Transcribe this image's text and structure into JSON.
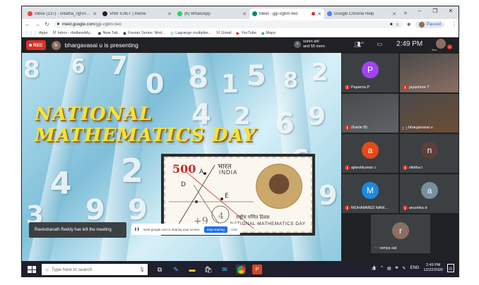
{
  "browser": {
    "tabs": [
      {
        "label": "Inbox (137) - srilatha_r@vnrvjiet.in",
        "icon_color": "#ea4335",
        "active": false
      },
      {
        "label": "VNR VJIET | Home",
        "icon_color": "#202124",
        "active": false
      },
      {
        "label": "(6) WhatsApp",
        "icon_color": "#25d366",
        "active": false
      },
      {
        "label": "Meet - ggi-vgbm-two",
        "icon_color": "#00897b",
        "active": true
      },
      {
        "label": "Google Chrome Help",
        "icon_color": "#4285f4",
        "active": false
      }
    ],
    "new_tab": "+",
    "window_controls": [
      "–",
      "❐",
      "✕"
    ],
    "url_host": "meet.google.com",
    "url_path": "/ggi-vgbm-two",
    "paused_label": "Paused",
    "bookmarks": [
      {
        "label": "Apps",
        "icon": "⋮⋮⋮",
        "color": "#1a73e8"
      },
      {
        "label": "Inbox - rbollareddy...",
        "icon": "M",
        "color": "#ea4335"
      },
      {
        "label": "New Tab",
        "icon": "◉",
        "color": "#202124"
      },
      {
        "label": "Fourier Series: Mod...",
        "icon": "◉",
        "color": "#202124"
      },
      {
        "label": "Lagrange multiplier...",
        "icon": "◎",
        "color": "#34a853"
      },
      {
        "label": "Gmail",
        "icon": "M",
        "color": "#ea4335"
      },
      {
        "label": "YouTube",
        "icon": "▶",
        "color": "#ff0000"
      },
      {
        "label": "Maps",
        "icon": "◆",
        "color": "#34a853"
      }
    ]
  },
  "meet": {
    "rec_label": "REC",
    "presenter_initial": "b",
    "presenter_text": "bhargavasai u is presenting",
    "others_initial": "s",
    "others_line1": "suren ahi",
    "others_line2": "and 55 more",
    "people_count": "57",
    "clock": "2:49 PM",
    "self_label": "You",
    "self_badge": "6"
  },
  "presentation": {
    "title_line1": "NATIONAL",
    "title_line2": "MATHEMATICS DAY",
    "stamp_value": "500",
    "stamp_value_unit": "",
    "stamp_hindi_top": "भारत",
    "stamp_india": "INDIA",
    "stamp_hindi_bottom": "राष्ट्रीय गणित दिवस",
    "stamp_english_bottom": "NATIONAL MATHEMATICS DAY",
    "toast": "Ravindranath Reddy has left the meeting",
    "share_text": "meet.google.com is sharing your screen.",
    "stop_sharing": "Stop sharing",
    "hide": "Hide"
  },
  "participants": [
    {
      "name": "Paparna P",
      "initial": "P",
      "color": "#a142f4",
      "muted": true
    },
    {
      "name": "jayashree T",
      "initial": "",
      "color": "#8d6e63",
      "muted": true
    },
    {
      "name": "(Kariie B)",
      "initial": "",
      "color": "#5f6368",
      "muted": true
    },
    {
      "name": "bhargavasai u",
      "initial": "",
      "color": "#6d4c33",
      "muted": false
    },
    {
      "name": "ajiteshkumar c",
      "initial": "a",
      "color": "#e64a19",
      "muted": true
    },
    {
      "name": "nikitha t",
      "initial": "n",
      "color": "#5d4037",
      "muted": true
    },
    {
      "name": "MOHAMMED NAW...",
      "initial": "M",
      "color": "#1e88e5",
      "muted": true
    },
    {
      "name": "anushka d",
      "initial": "a",
      "color": "#78909c",
      "muted": true
    },
    {
      "name": "ramya sai",
      "initial": "r",
      "color": "#8d6e63",
      "muted": false
    }
  ],
  "taskbar": {
    "search_placeholder": "Type here to search",
    "lang": "ENG",
    "time": "2:49 PM",
    "date": "12/22/2020",
    "notif_count": "21"
  }
}
